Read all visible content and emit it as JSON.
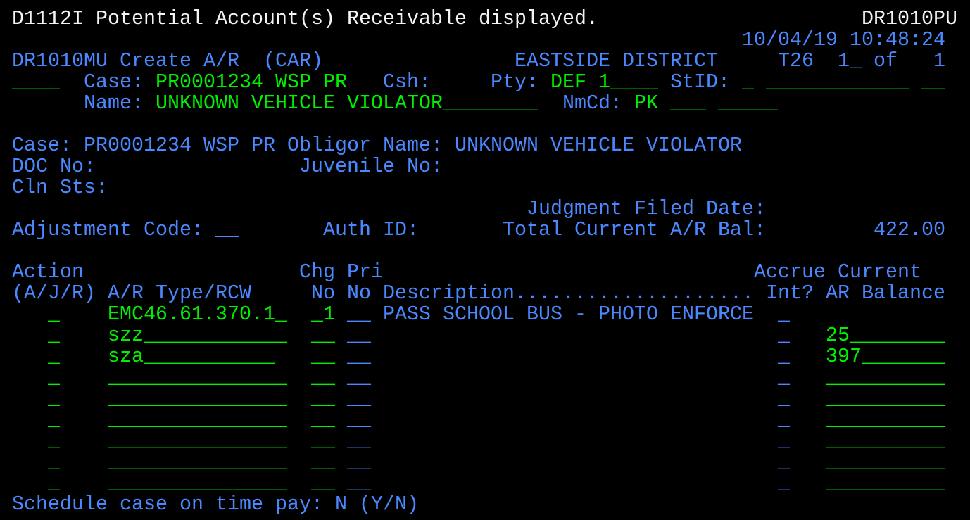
{
  "colors": {
    "protected": "#4a88ff",
    "input": "#00f000",
    "message": "#f4f4f4",
    "background": "#000000"
  },
  "header": {
    "message": "D1112I Potential Account(s) Receivable displayed.",
    "screen_id": "DR1010PU",
    "date_time": "10/04/19 10:48:24",
    "program_title": "DR1010MU Create A/R  (CAR)",
    "district": "EASTSIDE DISTRICT",
    "terminal": "T26",
    "page_current": "1_",
    "page_of": "of",
    "page_total": "1"
  },
  "command_field": "____",
  "case": {
    "label": "Case:",
    "value": "PR0001234 WSP PR",
    "csh_label": "Csh:",
    "pty_label": "Pty:",
    "pty_type": "DEF",
    "pty_number": "1____",
    "stid_label": "StID:",
    "stid_1": "_",
    "stid_2": "____________",
    "stid_3": "__"
  },
  "name": {
    "label": "Name:",
    "value": "UNKNOWN VEHICLE VIOLATOR________",
    "nmcd_label": "NmCd:",
    "nmcd_value": "PK",
    "nmcd_2": "___",
    "nmcd_3": "_____"
  },
  "summary": {
    "case_label": "Case:",
    "case_value": "PR0001234 WSP PR",
    "obligor_label": "Obligor Name:",
    "obligor_value": "UNKNOWN VEHICLE VIOLATOR",
    "doc_no_label": "DOC No:",
    "juvenile_no_label": "Juvenile No:",
    "cln_sts_label": "Cln Sts:",
    "judgment_label": "Judgment Filed Date:",
    "adjustment_label": "Adjustment Code:",
    "adjustment_value": "__",
    "auth_id_label": "Auth ID:",
    "total_label": "Total Current A/R Bal:",
    "total_value": "422.00"
  },
  "table": {
    "headers_top": {
      "action": "Action",
      "chg": "Chg",
      "pri": "Pri",
      "accrue": "Accrue",
      "current": "Current"
    },
    "headers_bottom": {
      "action": "(A/J/R)",
      "type": "A/R Type/RCW",
      "chg": "No",
      "pri": "No",
      "description": "Description....................",
      "accrue": "Int?",
      "balance": "AR Balance"
    },
    "rows": [
      {
        "action": "_",
        "type": "EMC46.61.370.1_",
        "chg": "_1",
        "pri": "__",
        "description": "PASS SCHOOL BUS - PHOTO ENFORCE",
        "accrue": "_",
        "balance": ""
      },
      {
        "action": "_",
        "type": "szz____________",
        "chg": "__",
        "pri": "__",
        "description": "",
        "accrue": "_",
        "balance": "25________"
      },
      {
        "action": "_",
        "type": "sza___________",
        "chg": "__",
        "pri": "__",
        "description": "",
        "accrue": "_",
        "balance": "397_______"
      },
      {
        "action": "_",
        "type": "_______________",
        "chg": "__",
        "pri": "__",
        "description": "",
        "accrue": "_",
        "balance": "__________"
      },
      {
        "action": "_",
        "type": "_______________",
        "chg": "__",
        "pri": "__",
        "description": "",
        "accrue": "_",
        "balance": "__________"
      },
      {
        "action": "_",
        "type": "_______________",
        "chg": "__",
        "pri": "__",
        "description": "",
        "accrue": "_",
        "balance": "__________"
      },
      {
        "action": "_",
        "type": "_______________",
        "chg": "__",
        "pri": "__",
        "description": "",
        "accrue": "_",
        "balance": "__________"
      },
      {
        "action": "_",
        "type": "_______________",
        "chg": "__",
        "pri": "__",
        "description": "",
        "accrue": "_",
        "balance": "__________"
      },
      {
        "action": "_",
        "type": "_______________",
        "chg": "__",
        "pri": "__",
        "description": "",
        "accrue": "_",
        "balance": "__________"
      }
    ]
  },
  "footer": {
    "schedule_label": "Schedule case on time pay:",
    "schedule_value": "N",
    "schedule_options": "(Y/N)"
  }
}
